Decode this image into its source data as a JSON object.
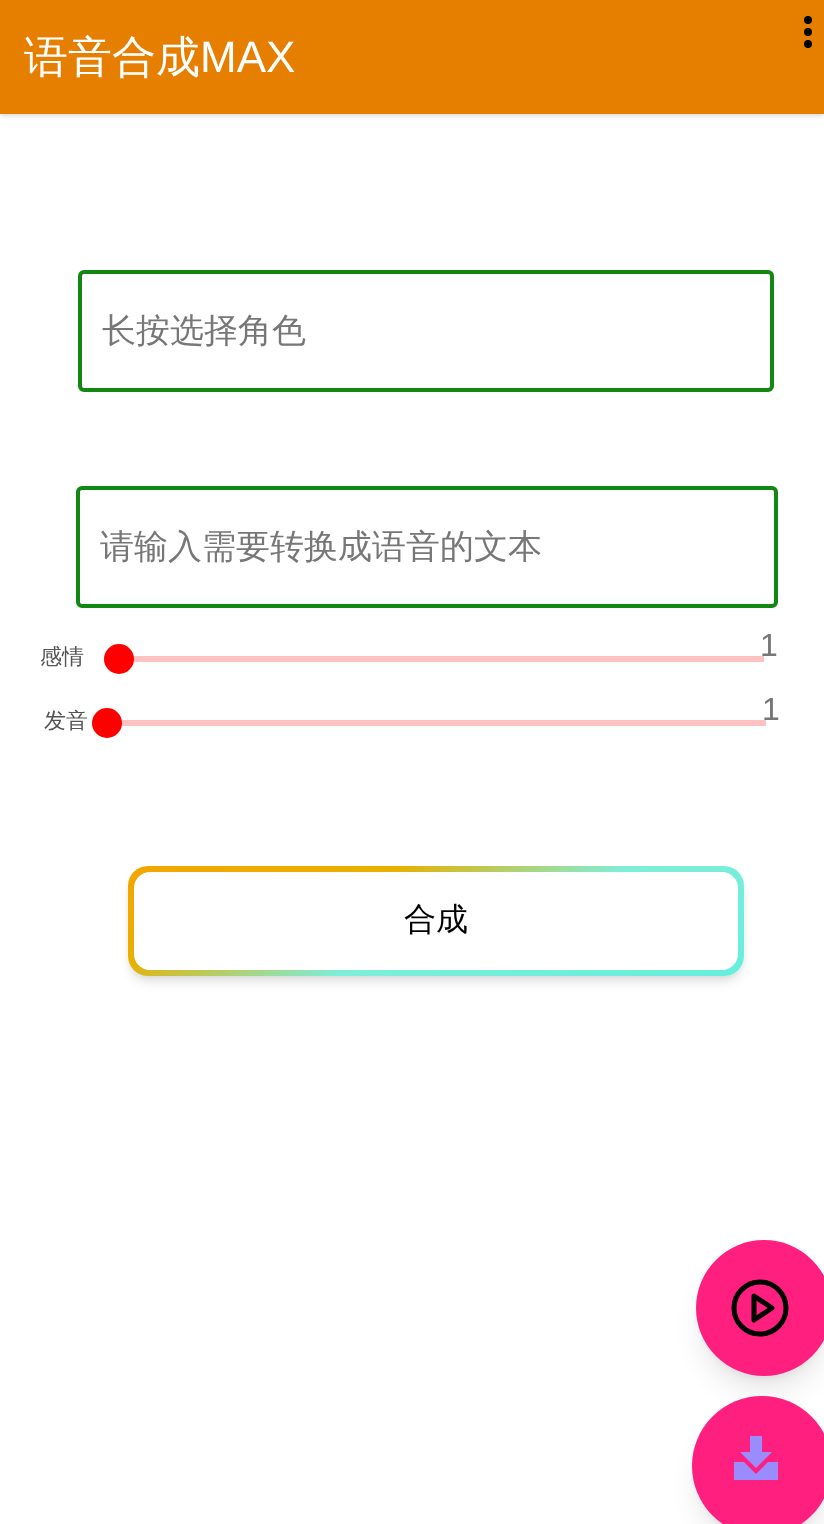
{
  "app_bar": {
    "title": "语音合成MAX"
  },
  "fields": [
    {
      "placeholder": "长按选择角色"
    },
    {
      "placeholder": "请输入需要转换成语音的文本"
    }
  ],
  "sliders": [
    {
      "label": "感情",
      "level": 0,
      "reading": "1"
    },
    {
      "label": "发音",
      "level": 0,
      "reading": "1"
    }
  ],
  "synthesize_button": {
    "label": "合成"
  }
}
